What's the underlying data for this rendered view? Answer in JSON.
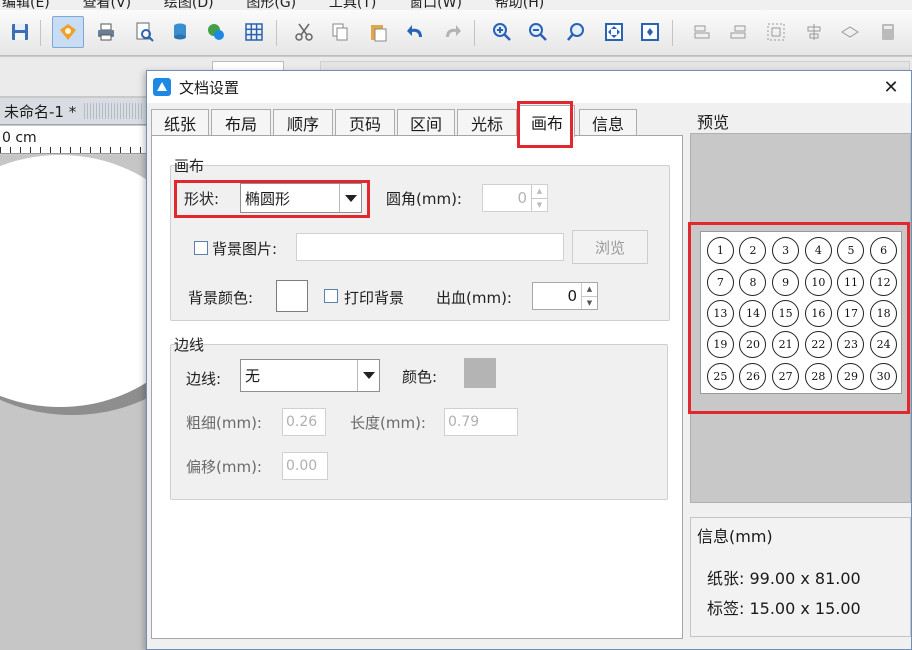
{
  "app": {
    "menu_items": [
      "编辑(E)",
      "查看(V)",
      "绘图(D)",
      "图形(G)",
      "工具(T)",
      "窗口(W)",
      "帮助(H)"
    ],
    "document_tab": "未命名-1 *",
    "ruler_unit": "0 cm"
  },
  "dialog": {
    "title": "文档设置",
    "close_glyph": "✕",
    "tabs": [
      "纸张",
      "布局",
      "顺序",
      "页码",
      "区间",
      "光标",
      "画布",
      "信息"
    ],
    "active_tab": "画布",
    "canvas_group": {
      "title": "画布",
      "shape_label": "形状:",
      "shape_value": "椭圆形",
      "corner_label": "圆角(mm):",
      "corner_value": "0",
      "bg_image_label": "背景图片:",
      "bg_image_value": "",
      "browse_label": "浏览",
      "bg_color_label": "背景颜色:",
      "bg_color": "#ffffff",
      "print_bg_label": "打印背景",
      "bleed_label": "出血(mm):",
      "bleed_value": "0"
    },
    "border_group": {
      "title": "边线",
      "border_label": "边线:",
      "border_value": "无",
      "color_label": "颜色:",
      "color": "#b4b4b4",
      "thickness_label": "粗细(mm):",
      "thickness_value": "0.26",
      "length_label": "长度(mm):",
      "length_value": "0.79",
      "offset_label": "偏移(mm):",
      "offset_value": "0.00"
    },
    "preview": {
      "title": "预览",
      "labels": [
        "1",
        "2",
        "3",
        "4",
        "5",
        "6",
        "7",
        "8",
        "9",
        "10",
        "11",
        "12",
        "13",
        "14",
        "15",
        "16",
        "17",
        "18",
        "19",
        "20",
        "21",
        "22",
        "23",
        "24",
        "25",
        "26",
        "27",
        "28",
        "29",
        "30"
      ]
    },
    "info": {
      "title": "信息(mm)",
      "paper": "纸张:  99.00 x 81.00",
      "label": "标签:  15.00 x 15.00"
    }
  },
  "colors": {
    "highlight": "#e0282e",
    "dialog_border": "#6f8fb8"
  }
}
